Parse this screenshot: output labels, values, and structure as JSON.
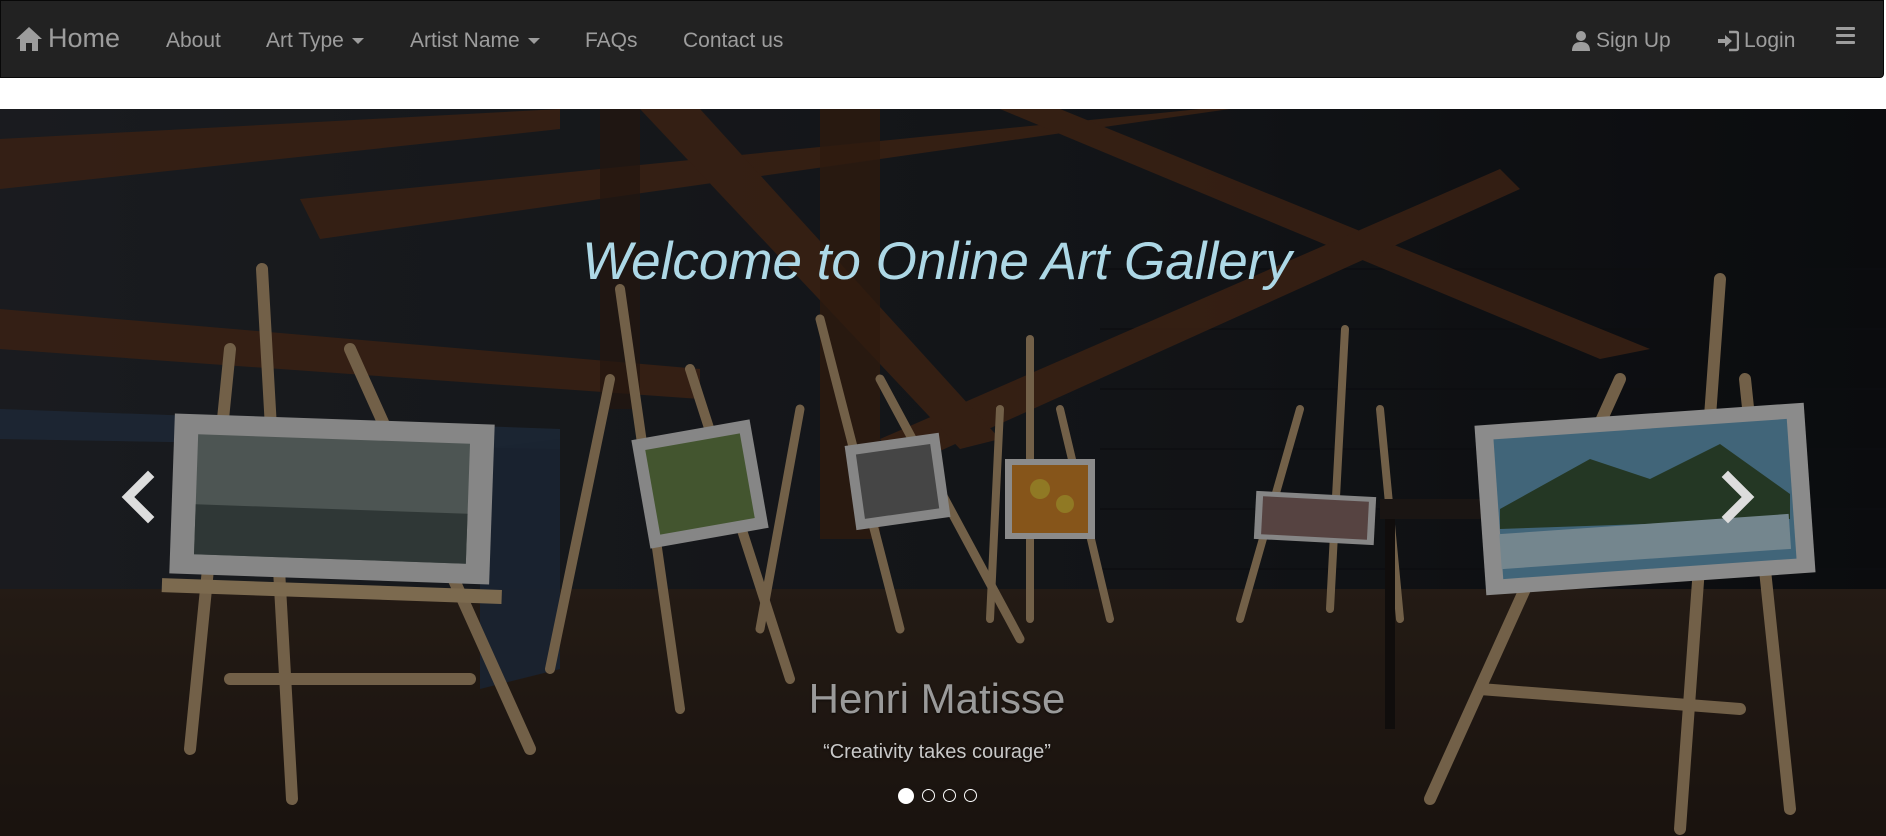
{
  "navbar": {
    "home": {
      "label": "Home",
      "icon": "home-icon"
    },
    "links": [
      {
        "label": "About"
      },
      {
        "label": "Art Type",
        "dropdown": true
      },
      {
        "label": "Artist Name",
        "dropdown": true
      },
      {
        "label": "FAQs"
      },
      {
        "label": "Contact us"
      }
    ],
    "right": {
      "signup": {
        "label": "Sign Up",
        "icon": "user-icon"
      },
      "login": {
        "label": "Login",
        "icon": "login-icon"
      },
      "menu_icon": "hamburger-menu-icon"
    }
  },
  "carousel": {
    "headline": "Welcome to Online Art Gallery",
    "caption_title": "Henri Matisse",
    "caption_quote": "“Creativity takes courage”",
    "slide_count": 4,
    "active_slide": 1,
    "prev_icon": "chevron-left-icon",
    "next_icon": "chevron-right-icon"
  },
  "colors": {
    "navbar_bg": "#222222",
    "nav_text": "#9d9d9d",
    "headline": "#add8e6"
  }
}
